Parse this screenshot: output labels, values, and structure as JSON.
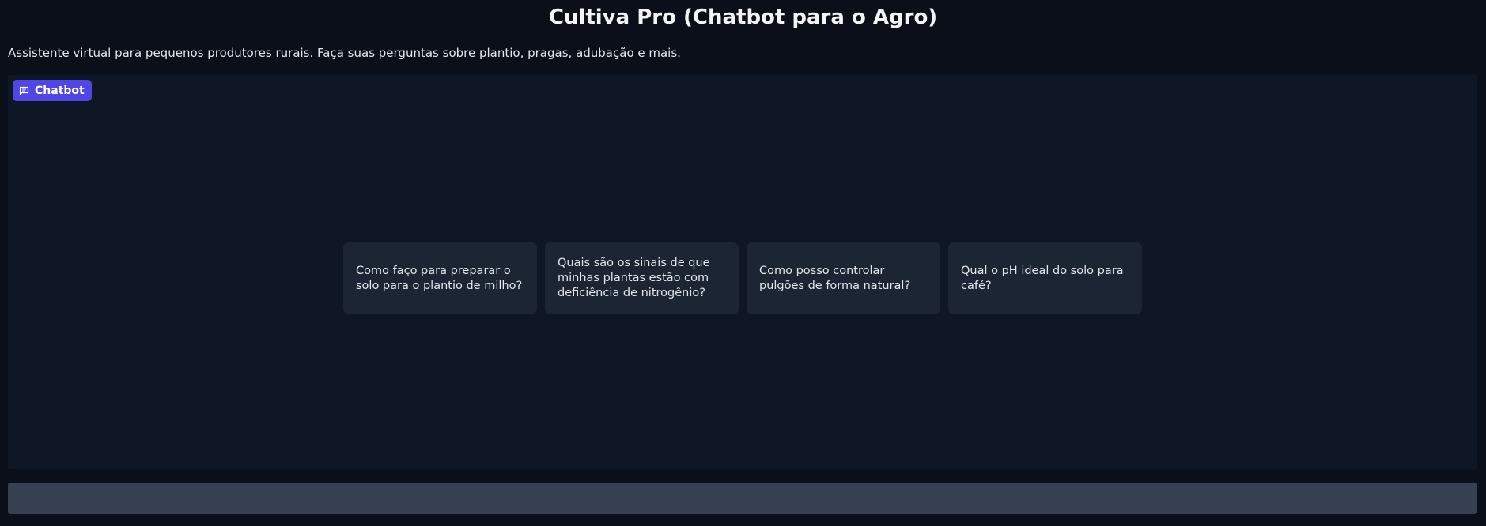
{
  "header": {
    "title": "Cultiva Pro (Chatbot para o Agro)",
    "subtitle": "Assistente virtual para pequenos produtores rurais. Faça suas perguntas sobre plantio, pragas, adubação e mais."
  },
  "chatbot": {
    "label": "Chatbot",
    "label_icon": "chat-bubble-icon",
    "accent_color": "#4f46e5",
    "examples": [
      "Como faço para preparar o solo para o plantio de milho?",
      "Quais são os sinais de que minhas plantas estão com deficiência de nitrogênio?",
      "Como posso controlar pulgões de forma natural?",
      "Qual o pH ideal do solo para café?"
    ]
  },
  "input": {
    "value": "",
    "placeholder": ""
  }
}
